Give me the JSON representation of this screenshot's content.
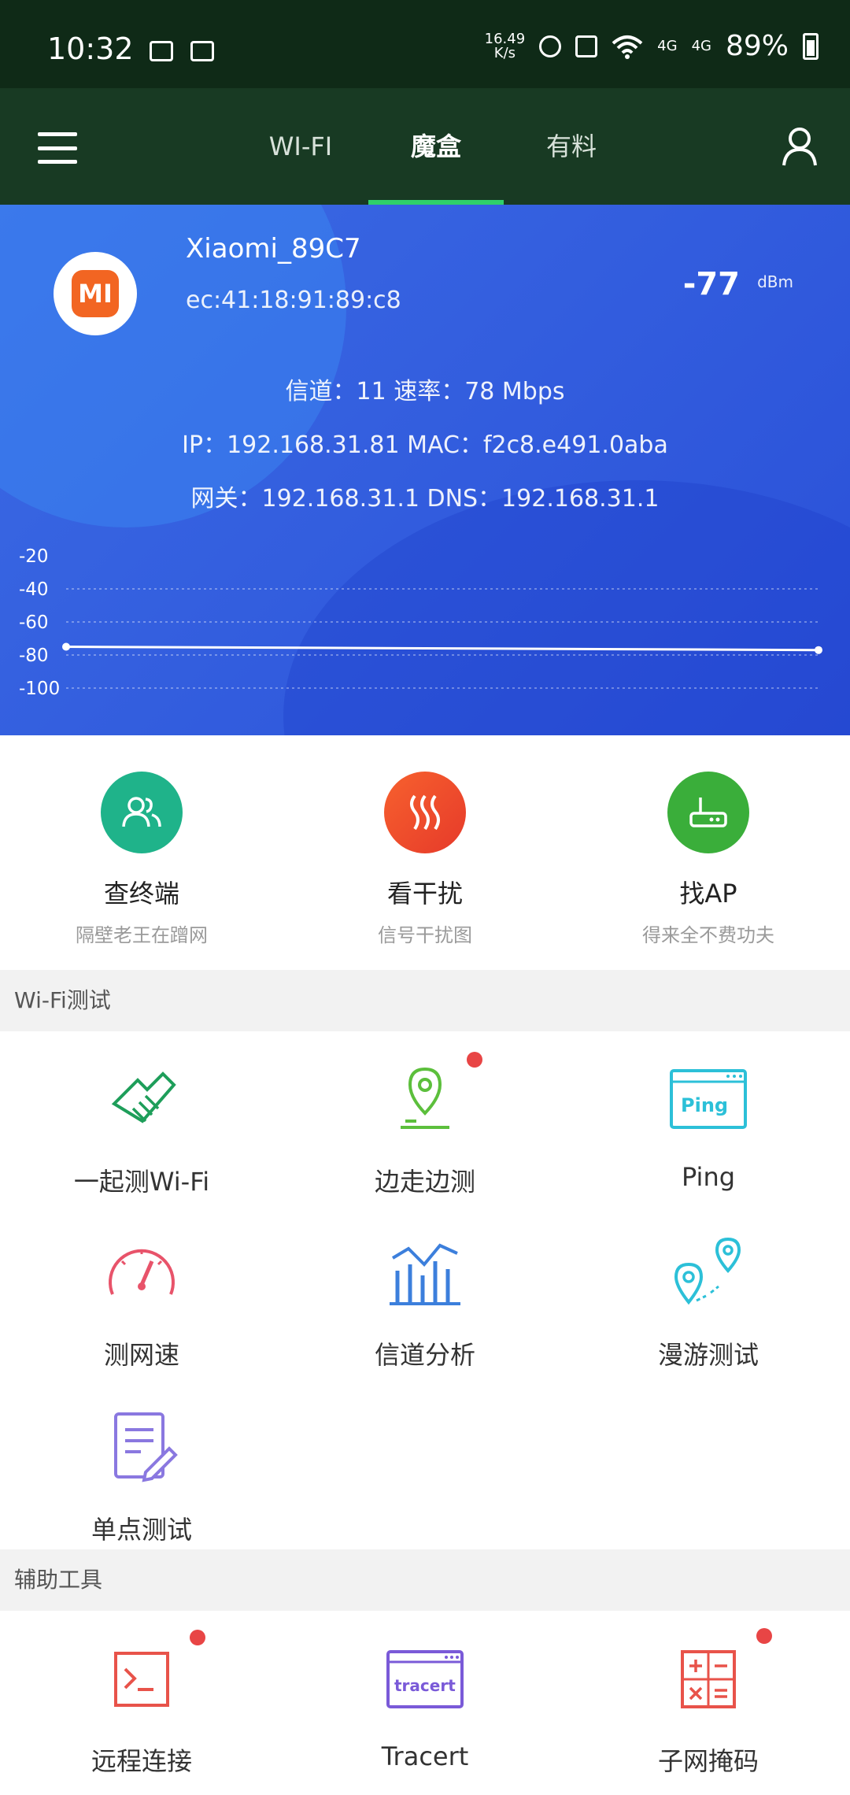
{
  "status_bar": {
    "time": "10:32",
    "speed_value": "16.49",
    "speed_unit": "K/s",
    "network_labels": [
      "4G",
      "4G"
    ],
    "battery": "89%"
  },
  "nav": {
    "tabs": [
      {
        "label": "WI-FI",
        "active": false
      },
      {
        "label": "魔盒",
        "active": true
      },
      {
        "label": "有料",
        "active": false
      }
    ]
  },
  "wifi": {
    "ssid": "Xiaomi_89C7",
    "bssid": "ec:41:18:91:89:c8",
    "rssi": "-77",
    "rssi_unit": "dBm",
    "logo_text": "MI",
    "line1": "信道：11  速率：78 Mbps",
    "line2": "IP：192.168.31.81  MAC：f2c8.e491.0aba",
    "line3": "网关：192.168.31.1  DNS：192.168.31.1"
  },
  "chart_data": {
    "type": "line",
    "title": "",
    "xlabel": "",
    "ylabel": "",
    "ylim": [
      -100,
      -20
    ],
    "y_ticks": [
      "-20",
      "-40",
      "-60",
      "-80",
      "-100"
    ],
    "grid": true,
    "series": [
      {
        "values": [
          -75,
          -77
        ]
      }
    ]
  },
  "quick_tools": [
    {
      "title": "查终端",
      "subtitle": "隔壁老王在蹭网",
      "color": "#1fb38a"
    },
    {
      "title": "看干扰",
      "subtitle": "信号干扰图",
      "color": "#f0502a"
    },
    {
      "title": "找AP",
      "subtitle": "得来全不费功夫",
      "color": "#3aae3a"
    }
  ],
  "sections": {
    "wifi_test": "Wi-Fi测试",
    "aux_tools": "辅助工具"
  },
  "wifi_tests": [
    {
      "label": "一起测Wi-Fi",
      "icon": "handshake-icon",
      "color": "#1e9e5a",
      "badge": false
    },
    {
      "label": "边走边测",
      "icon": "location-walk-icon",
      "color": "#5cbf3c",
      "badge": true
    },
    {
      "label": "Ping",
      "icon": "ping-window-icon",
      "color": "#2cc0d8",
      "badge": false,
      "icon_text": "Ping"
    },
    {
      "label": "测网速",
      "icon": "speedometer-icon",
      "color": "#e8536a",
      "badge": false
    },
    {
      "label": "信道分析",
      "icon": "channel-bars-icon",
      "color": "#3c7fdc",
      "badge": false
    },
    {
      "label": "漫游测试",
      "icon": "roaming-pins-icon",
      "color": "#2cc0d8",
      "badge": false
    },
    {
      "label": "单点测试",
      "icon": "document-edit-icon",
      "color": "#8a78e0",
      "badge": false
    }
  ],
  "aux": [
    {
      "label": "远程连接",
      "icon": "terminal-icon",
      "color": "#e8534a",
      "badge": true
    },
    {
      "label": "Tracert",
      "icon": "tracert-window-icon",
      "color": "#7a5ad8",
      "badge": false,
      "icon_text": "tracert"
    },
    {
      "label": "子网掩码",
      "icon": "calculator-icon",
      "color": "#e8534a",
      "badge": true
    }
  ]
}
